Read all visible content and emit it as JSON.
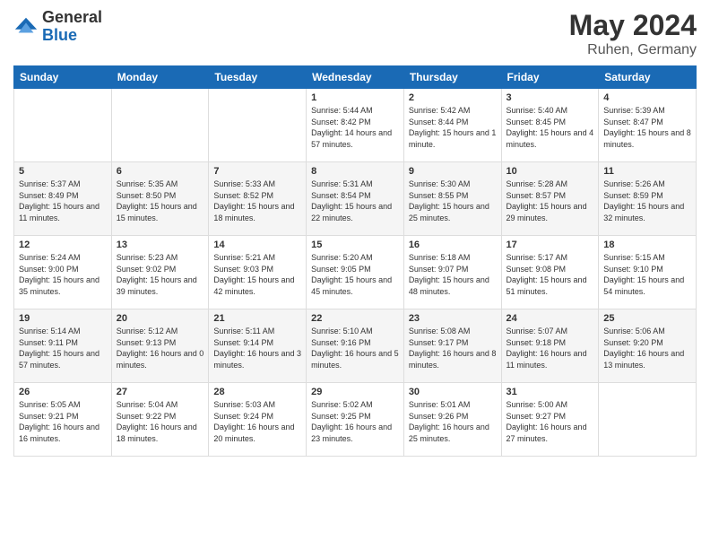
{
  "logo": {
    "general": "General",
    "blue": "Blue"
  },
  "title": {
    "month": "May 2024",
    "location": "Ruhen, Germany"
  },
  "weekdays": [
    "Sunday",
    "Monday",
    "Tuesday",
    "Wednesday",
    "Thursday",
    "Friday",
    "Saturday"
  ],
  "weeks": [
    [
      {
        "day": "",
        "sunrise": "",
        "sunset": "",
        "daylight": ""
      },
      {
        "day": "",
        "sunrise": "",
        "sunset": "",
        "daylight": ""
      },
      {
        "day": "",
        "sunrise": "",
        "sunset": "",
        "daylight": ""
      },
      {
        "day": "1",
        "sunrise": "Sunrise: 5:44 AM",
        "sunset": "Sunset: 8:42 PM",
        "daylight": "Daylight: 14 hours and 57 minutes."
      },
      {
        "day": "2",
        "sunrise": "Sunrise: 5:42 AM",
        "sunset": "Sunset: 8:44 PM",
        "daylight": "Daylight: 15 hours and 1 minute."
      },
      {
        "day": "3",
        "sunrise": "Sunrise: 5:40 AM",
        "sunset": "Sunset: 8:45 PM",
        "daylight": "Daylight: 15 hours and 4 minutes."
      },
      {
        "day": "4",
        "sunrise": "Sunrise: 5:39 AM",
        "sunset": "Sunset: 8:47 PM",
        "daylight": "Daylight: 15 hours and 8 minutes."
      }
    ],
    [
      {
        "day": "5",
        "sunrise": "Sunrise: 5:37 AM",
        "sunset": "Sunset: 8:49 PM",
        "daylight": "Daylight: 15 hours and 11 minutes."
      },
      {
        "day": "6",
        "sunrise": "Sunrise: 5:35 AM",
        "sunset": "Sunset: 8:50 PM",
        "daylight": "Daylight: 15 hours and 15 minutes."
      },
      {
        "day": "7",
        "sunrise": "Sunrise: 5:33 AM",
        "sunset": "Sunset: 8:52 PM",
        "daylight": "Daylight: 15 hours and 18 minutes."
      },
      {
        "day": "8",
        "sunrise": "Sunrise: 5:31 AM",
        "sunset": "Sunset: 8:54 PM",
        "daylight": "Daylight: 15 hours and 22 minutes."
      },
      {
        "day": "9",
        "sunrise": "Sunrise: 5:30 AM",
        "sunset": "Sunset: 8:55 PM",
        "daylight": "Daylight: 15 hours and 25 minutes."
      },
      {
        "day": "10",
        "sunrise": "Sunrise: 5:28 AM",
        "sunset": "Sunset: 8:57 PM",
        "daylight": "Daylight: 15 hours and 29 minutes."
      },
      {
        "day": "11",
        "sunrise": "Sunrise: 5:26 AM",
        "sunset": "Sunset: 8:59 PM",
        "daylight": "Daylight: 15 hours and 32 minutes."
      }
    ],
    [
      {
        "day": "12",
        "sunrise": "Sunrise: 5:24 AM",
        "sunset": "Sunset: 9:00 PM",
        "daylight": "Daylight: 15 hours and 35 minutes."
      },
      {
        "day": "13",
        "sunrise": "Sunrise: 5:23 AM",
        "sunset": "Sunset: 9:02 PM",
        "daylight": "Daylight: 15 hours and 39 minutes."
      },
      {
        "day": "14",
        "sunrise": "Sunrise: 5:21 AM",
        "sunset": "Sunset: 9:03 PM",
        "daylight": "Daylight: 15 hours and 42 minutes."
      },
      {
        "day": "15",
        "sunrise": "Sunrise: 5:20 AM",
        "sunset": "Sunset: 9:05 PM",
        "daylight": "Daylight: 15 hours and 45 minutes."
      },
      {
        "day": "16",
        "sunrise": "Sunrise: 5:18 AM",
        "sunset": "Sunset: 9:07 PM",
        "daylight": "Daylight: 15 hours and 48 minutes."
      },
      {
        "day": "17",
        "sunrise": "Sunrise: 5:17 AM",
        "sunset": "Sunset: 9:08 PM",
        "daylight": "Daylight: 15 hours and 51 minutes."
      },
      {
        "day": "18",
        "sunrise": "Sunrise: 5:15 AM",
        "sunset": "Sunset: 9:10 PM",
        "daylight": "Daylight: 15 hours and 54 minutes."
      }
    ],
    [
      {
        "day": "19",
        "sunrise": "Sunrise: 5:14 AM",
        "sunset": "Sunset: 9:11 PM",
        "daylight": "Daylight: 15 hours and 57 minutes."
      },
      {
        "day": "20",
        "sunrise": "Sunrise: 5:12 AM",
        "sunset": "Sunset: 9:13 PM",
        "daylight": "Daylight: 16 hours and 0 minutes."
      },
      {
        "day": "21",
        "sunrise": "Sunrise: 5:11 AM",
        "sunset": "Sunset: 9:14 PM",
        "daylight": "Daylight: 16 hours and 3 minutes."
      },
      {
        "day": "22",
        "sunrise": "Sunrise: 5:10 AM",
        "sunset": "Sunset: 9:16 PM",
        "daylight": "Daylight: 16 hours and 5 minutes."
      },
      {
        "day": "23",
        "sunrise": "Sunrise: 5:08 AM",
        "sunset": "Sunset: 9:17 PM",
        "daylight": "Daylight: 16 hours and 8 minutes."
      },
      {
        "day": "24",
        "sunrise": "Sunrise: 5:07 AM",
        "sunset": "Sunset: 9:18 PM",
        "daylight": "Daylight: 16 hours and 11 minutes."
      },
      {
        "day": "25",
        "sunrise": "Sunrise: 5:06 AM",
        "sunset": "Sunset: 9:20 PM",
        "daylight": "Daylight: 16 hours and 13 minutes."
      }
    ],
    [
      {
        "day": "26",
        "sunrise": "Sunrise: 5:05 AM",
        "sunset": "Sunset: 9:21 PM",
        "daylight": "Daylight: 16 hours and 16 minutes."
      },
      {
        "day": "27",
        "sunrise": "Sunrise: 5:04 AM",
        "sunset": "Sunset: 9:22 PM",
        "daylight": "Daylight: 16 hours and 18 minutes."
      },
      {
        "day": "28",
        "sunrise": "Sunrise: 5:03 AM",
        "sunset": "Sunset: 9:24 PM",
        "daylight": "Daylight: 16 hours and 20 minutes."
      },
      {
        "day": "29",
        "sunrise": "Sunrise: 5:02 AM",
        "sunset": "Sunset: 9:25 PM",
        "daylight": "Daylight: 16 hours and 23 minutes."
      },
      {
        "day": "30",
        "sunrise": "Sunrise: 5:01 AM",
        "sunset": "Sunset: 9:26 PM",
        "daylight": "Daylight: 16 hours and 25 minutes."
      },
      {
        "day": "31",
        "sunrise": "Sunrise: 5:00 AM",
        "sunset": "Sunset: 9:27 PM",
        "daylight": "Daylight: 16 hours and 27 minutes."
      },
      {
        "day": "",
        "sunrise": "",
        "sunset": "",
        "daylight": ""
      }
    ]
  ]
}
